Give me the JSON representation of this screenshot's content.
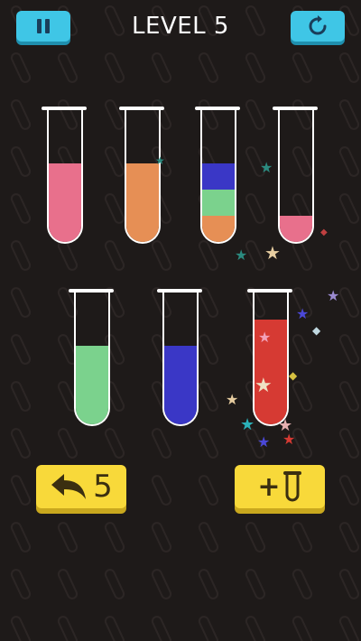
{
  "header": {
    "level_title": "LEVEL 5",
    "pause_icon": "pause-icon",
    "restart_icon": "restart-icon"
  },
  "tubes": [
    {
      "id": 1,
      "layers": [
        {
          "color": "#e8708c",
          "amount": 0.6
        }
      ]
    },
    {
      "id": 2,
      "layers": [
        {
          "color": "#e68f55",
          "amount": 0.6
        }
      ]
    },
    {
      "id": 3,
      "layers": [
        {
          "color": "#e68f55",
          "amount": 0.2
        },
        {
          "color": "#7bd28d",
          "amount": 0.2
        },
        {
          "color": "#3a37c6",
          "amount": 0.2
        }
      ]
    },
    {
      "id": 4,
      "layers": [
        {
          "color": "#e8708c",
          "amount": 0.2
        }
      ]
    },
    {
      "id": 5,
      "layers": [
        {
          "color": "#7bd28d",
          "amount": 0.6
        }
      ]
    },
    {
      "id": 6,
      "layers": [
        {
          "color": "#3a37c6",
          "amount": 0.6
        }
      ]
    },
    {
      "id": 7,
      "layers": [
        {
          "color": "#d63a33",
          "amount": 0.8
        }
      ]
    }
  ],
  "controls": {
    "undo_count": "5",
    "undo_icon": "undo-arrow-icon",
    "add_tube_label": "+",
    "add_tube_icon": "test-tube-icon"
  },
  "colors": {
    "background": "#1e1a19",
    "top_button": "#3fc6e6",
    "bottom_button": "#f8d93a"
  }
}
